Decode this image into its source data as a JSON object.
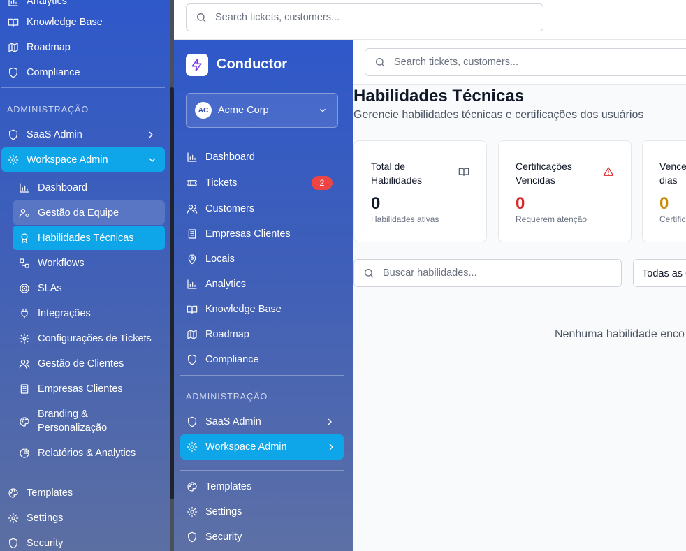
{
  "search": {
    "placeholder": "Search tickets, customers..."
  },
  "outer_sidebar": {
    "items_top": [
      {
        "label": "Analytics",
        "icon": "bar-chart-icon"
      },
      {
        "label": "Knowledge Base",
        "icon": "book-icon"
      },
      {
        "label": "Roadmap",
        "icon": "map-icon"
      },
      {
        "label": "Compliance",
        "icon": "shield-icon"
      }
    ],
    "section_label": "ADMINISTRAÇÃO",
    "saas_admin": "SaaS Admin",
    "workspace_admin": "Workspace Admin",
    "sub_items": [
      {
        "label": "Dashboard",
        "icon": "bar-chart-icon"
      },
      {
        "label": "Gestão da Equipe",
        "icon": "users-cog-icon"
      },
      {
        "label": "Habilidades Técnicas",
        "icon": "award-icon"
      },
      {
        "label": "Workflows",
        "icon": "workflow-icon"
      },
      {
        "label": "SLAs",
        "icon": "target-icon"
      },
      {
        "label": "Integrações",
        "icon": "plug-icon"
      },
      {
        "label": "Configurações de Tickets",
        "icon": "gear-icon"
      },
      {
        "label": "Gestão de Clientes",
        "icon": "users-icon"
      },
      {
        "label": "Empresas Clientes",
        "icon": "building-icon"
      },
      {
        "label": "Branding & Personalização",
        "icon": "palette-icon"
      },
      {
        "label": "Relatórios & Analytics",
        "icon": "pie-chart-icon"
      }
    ],
    "items_bottom": [
      {
        "label": "Templates",
        "icon": "palette-icon"
      },
      {
        "label": "Settings",
        "icon": "gear-icon"
      },
      {
        "label": "Security",
        "icon": "shield-icon"
      }
    ]
  },
  "inner_sidebar": {
    "brand": "Conductor",
    "org": {
      "initials": "AC",
      "name": "Acme Corp"
    },
    "items": [
      {
        "label": "Dashboard",
        "icon": "bar-chart-icon"
      },
      {
        "label": "Tickets",
        "icon": "ticket-icon",
        "badge": "2"
      },
      {
        "label": "Customers",
        "icon": "users-icon"
      },
      {
        "label": "Empresas Clientes",
        "icon": "building-icon"
      },
      {
        "label": "Locais",
        "icon": "map-pin-icon"
      },
      {
        "label": "Analytics",
        "icon": "bar-chart-icon"
      },
      {
        "label": "Knowledge Base",
        "icon": "book-icon"
      },
      {
        "label": "Roadmap",
        "icon": "map-icon"
      },
      {
        "label": "Compliance",
        "icon": "shield-icon"
      }
    ],
    "section_label": "ADMINISTRAÇÃO",
    "saas_admin": "SaaS Admin",
    "workspace_admin": "Workspace Admin",
    "items_bottom": [
      {
        "label": "Templates",
        "icon": "palette-icon"
      },
      {
        "label": "Settings",
        "icon": "gear-icon"
      },
      {
        "label": "Security",
        "icon": "shield-icon"
      }
    ]
  },
  "main": {
    "title": "Habilidades Técnicas",
    "subtitle": "Gerencie habilidades técnicas e certificações dos usuários",
    "cards": [
      {
        "label": "Total de Habilidades",
        "value": "0",
        "desc": "Habilidades ativas",
        "value_color": "#111827",
        "icon": "book-icon"
      },
      {
        "label": "Certificações Vencidas",
        "value": "0",
        "desc": "Requerem atenção",
        "value_color": "#dc2626",
        "icon": "alert-triangle-icon"
      },
      {
        "label": "Vence dias",
        "value": "0",
        "desc": "Certific",
        "value_color": "#ca8a04",
        "icon": ""
      }
    ],
    "skills_search": {
      "placeholder": "Buscar habilidades..."
    },
    "filter": {
      "selected": "Todas as c"
    },
    "empty_text": "Nenhuma habilidade enco"
  },
  "colors": {
    "active_item": "#0ea5e9",
    "accent": "#2f58c9"
  }
}
